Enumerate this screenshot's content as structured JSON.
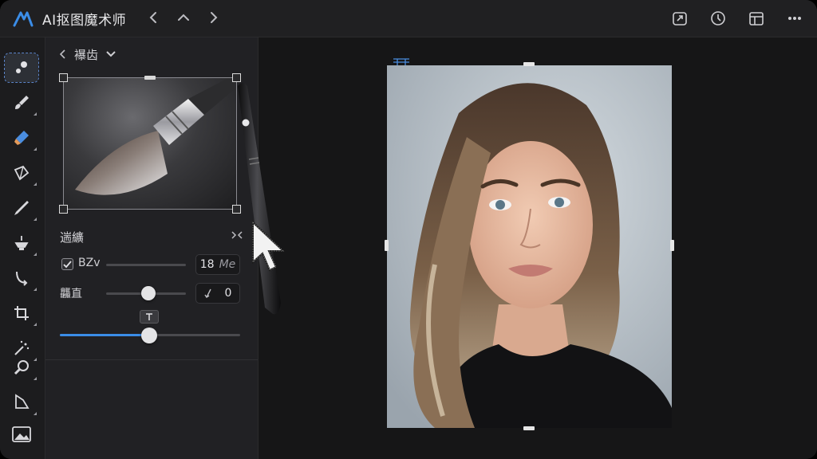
{
  "app": {
    "title": "AI抠图魔术师",
    "accent_color": "#3b8de8"
  },
  "titlebar": {
    "nav_icons": [
      "chevron-left-icon",
      "chevron-up-icon",
      "chevron-right-icon"
    ],
    "right_icons": [
      "export-icon",
      "history-icon",
      "layout-icon",
      "more-icon"
    ]
  },
  "toolbar": {
    "tools": [
      {
        "name": "brush-select-tool",
        "active": true
      },
      {
        "name": "paint-brush-tool"
      },
      {
        "name": "eraser-tool"
      },
      {
        "name": "lasso-tool"
      },
      {
        "name": "pen-tool"
      },
      {
        "name": "fill-tool"
      },
      {
        "name": "rotate-tool"
      },
      {
        "name": "crop-tool"
      },
      {
        "name": "magic-wand-tool"
      },
      {
        "name": "zoom-tool"
      },
      {
        "name": "perspective-tool"
      },
      {
        "name": "image-tool"
      }
    ]
  },
  "panel": {
    "header_label": "襮齿",
    "section_label": "遄纊",
    "row1": {
      "label": "BZv",
      "value": "18",
      "unit": "Me",
      "checked": true
    },
    "row2": {
      "label": "龘直",
      "value": "0",
      "slider_fraction": 0.5
    },
    "row3": {
      "slider_fraction": 0.49
    }
  }
}
